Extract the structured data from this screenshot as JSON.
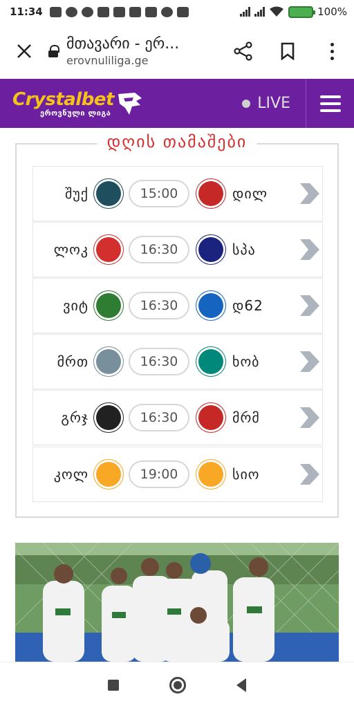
{
  "status_bar": {
    "time": "11:34",
    "battery_percent": "100%",
    "notification_icons": [
      "gallery-icon",
      "twitter-icon",
      "twitter-icon",
      "pocket-icon",
      "instagram-icon",
      "instagram-icon",
      "dropbox-icon",
      "whatsapp-icon",
      "sdcard-icon"
    ]
  },
  "browser": {
    "page_title": "მთავარი - ერ...",
    "domain": "erovnuliliga.ge"
  },
  "site_header": {
    "logo_main": "Crystalbet",
    "logo_sub": "ეროვნული ლიგა",
    "live_label": "LIVE",
    "brand_color": "#6c1f9e",
    "logo_color": "#f5c21b"
  },
  "matches_panel": {
    "title": "დღის თამაშები",
    "matches": [
      {
        "home": "შუქ",
        "time": "15:00",
        "away": "დილ",
        "home_color": "#1f4e5f",
        "away_color": "#c62828"
      },
      {
        "home": "ლოკ",
        "time": "16:30",
        "away": "სპა",
        "home_color": "#d32f2f",
        "away_color": "#1a237e"
      },
      {
        "home": "ვიტ",
        "time": "16:30",
        "away": "დ62",
        "home_color": "#2e7d32",
        "away_color": "#1565c0"
      },
      {
        "home": "მრთ",
        "time": "16:30",
        "away": "ხობ",
        "home_color": "#78909c",
        "away_color": "#00897b"
      },
      {
        "home": "გრჯ",
        "time": "16:30",
        "away": "მრმ",
        "home_color": "#212121",
        "away_color": "#c62828"
      },
      {
        "home": "კოლ",
        "time": "19:00",
        "away": "სიო",
        "home_color": "#f9a825",
        "away_color": "#f9a825"
      }
    ]
  }
}
